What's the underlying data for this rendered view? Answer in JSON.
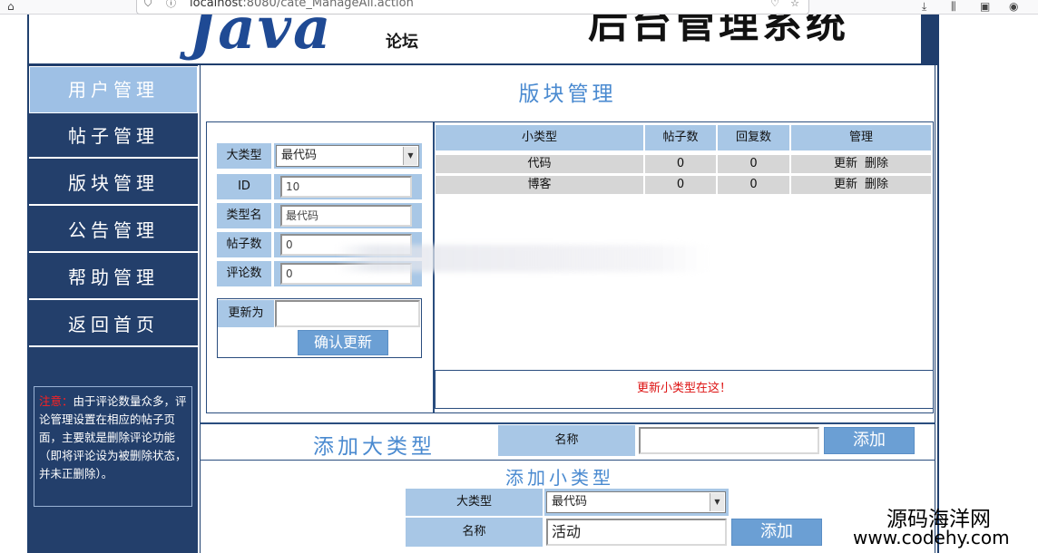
{
  "browser": {
    "url_host": "localhost",
    "url_rest": ":8080/cate_ManageAll.action"
  },
  "banner": {
    "logo_text": "Java",
    "logo_sub": "论坛",
    "system_title_cut": "后台管理系统"
  },
  "sidebar": {
    "items": [
      {
        "label": "用户管理"
      },
      {
        "label": "帖子管理"
      },
      {
        "label": "版块管理"
      },
      {
        "label": "公告管理"
      },
      {
        "label": "帮助管理"
      },
      {
        "label": "返回首页"
      }
    ],
    "notice_label": "注意：",
    "notice_text": "由于评论数量众多，评论管理设置在相应的帖子页面，主要就是删除评论功能（即将评论设为被删除状态，并未正删除）。"
  },
  "main": {
    "title": "版块管理"
  },
  "edit_form": {
    "big_type_label": "大类型",
    "big_type_value": "最代码",
    "id_label": "ID",
    "id_value": "10",
    "type_name_label": "类型名",
    "type_name_value": "最代码",
    "posts_label": "帖子数",
    "posts_value": "0",
    "comments_label": "评论数",
    "comments_value": "0",
    "update_to_label": "更新为",
    "update_to_value": "",
    "confirm_button": "确认更新"
  },
  "sub_table": {
    "headers": [
      "小类型",
      "帖子数",
      "回复数",
      "管理"
    ],
    "rows": [
      {
        "name": "代码",
        "posts": "0",
        "replies": "0",
        "update": "更新",
        "delete": "删除"
      },
      {
        "name": "博客",
        "posts": "0",
        "replies": "0",
        "update": "更新",
        "delete": "删除"
      }
    ],
    "update_hint": "更新小类型在这！"
  },
  "add_big": {
    "title": "添加大类型",
    "name_label": "名称",
    "name_value": "",
    "add_button": "添加"
  },
  "add_small": {
    "title": "添加小类型",
    "big_type_label": "大类型",
    "big_type_value": "最代码",
    "name_label": "名称",
    "name_value": "活动",
    "add_button": "添加"
  },
  "watermark": {
    "line1": "源码海洋网",
    "line2": "www.codehy.com"
  }
}
